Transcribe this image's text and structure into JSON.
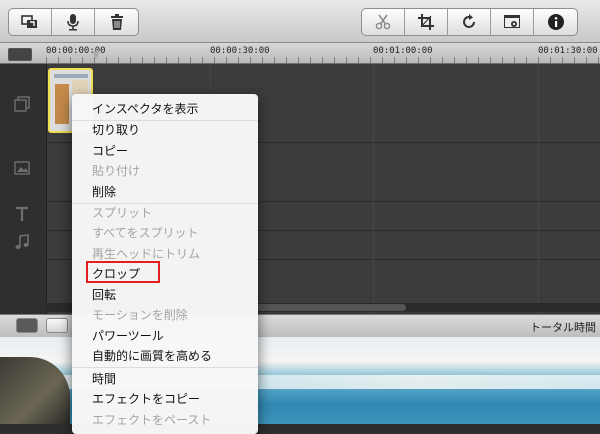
{
  "toolbar": {
    "left_icons": [
      "import-media-icon",
      "microphone-icon",
      "trash-icon"
    ],
    "right_icons": [
      "scissors-icon",
      "crop-icon",
      "rotate-icon",
      "export-settings-icon",
      "info-icon"
    ]
  },
  "ruler": {
    "timecodes": [
      "00:00:00:00",
      "00:00:30:00",
      "00:01:00:00",
      "00:01:30:00"
    ]
  },
  "bottom_bar": {
    "total_time_label": "トータル時間"
  },
  "context_menu": {
    "items": [
      {
        "label": "インスペクタを表示",
        "enabled": true
      },
      {
        "label": "切り取り",
        "enabled": true
      },
      {
        "label": "コピー",
        "enabled": true
      },
      {
        "label": "貼り付け",
        "enabled": false
      },
      {
        "label": "削除",
        "enabled": true
      },
      {
        "label": "スプリット",
        "enabled": false
      },
      {
        "label": "すべてをスプリット",
        "enabled": false
      },
      {
        "label": "再生ヘッドにトリム",
        "enabled": false
      },
      {
        "label": "クロップ",
        "enabled": true,
        "highlighted": true
      },
      {
        "label": "回転",
        "enabled": true
      },
      {
        "label": "モーションを削除",
        "enabled": false
      },
      {
        "label": "パワーツール",
        "enabled": true
      },
      {
        "label": "自動的に画質を高める",
        "enabled": true
      },
      {
        "label": "時間",
        "enabled": true
      },
      {
        "label": "エフェクトをコピー",
        "enabled": true
      },
      {
        "label": "エフェクトをペースト",
        "enabled": false
      }
    ]
  },
  "colors": {
    "highlight_box": "#e02020",
    "clip_selection": "#f0e050"
  }
}
